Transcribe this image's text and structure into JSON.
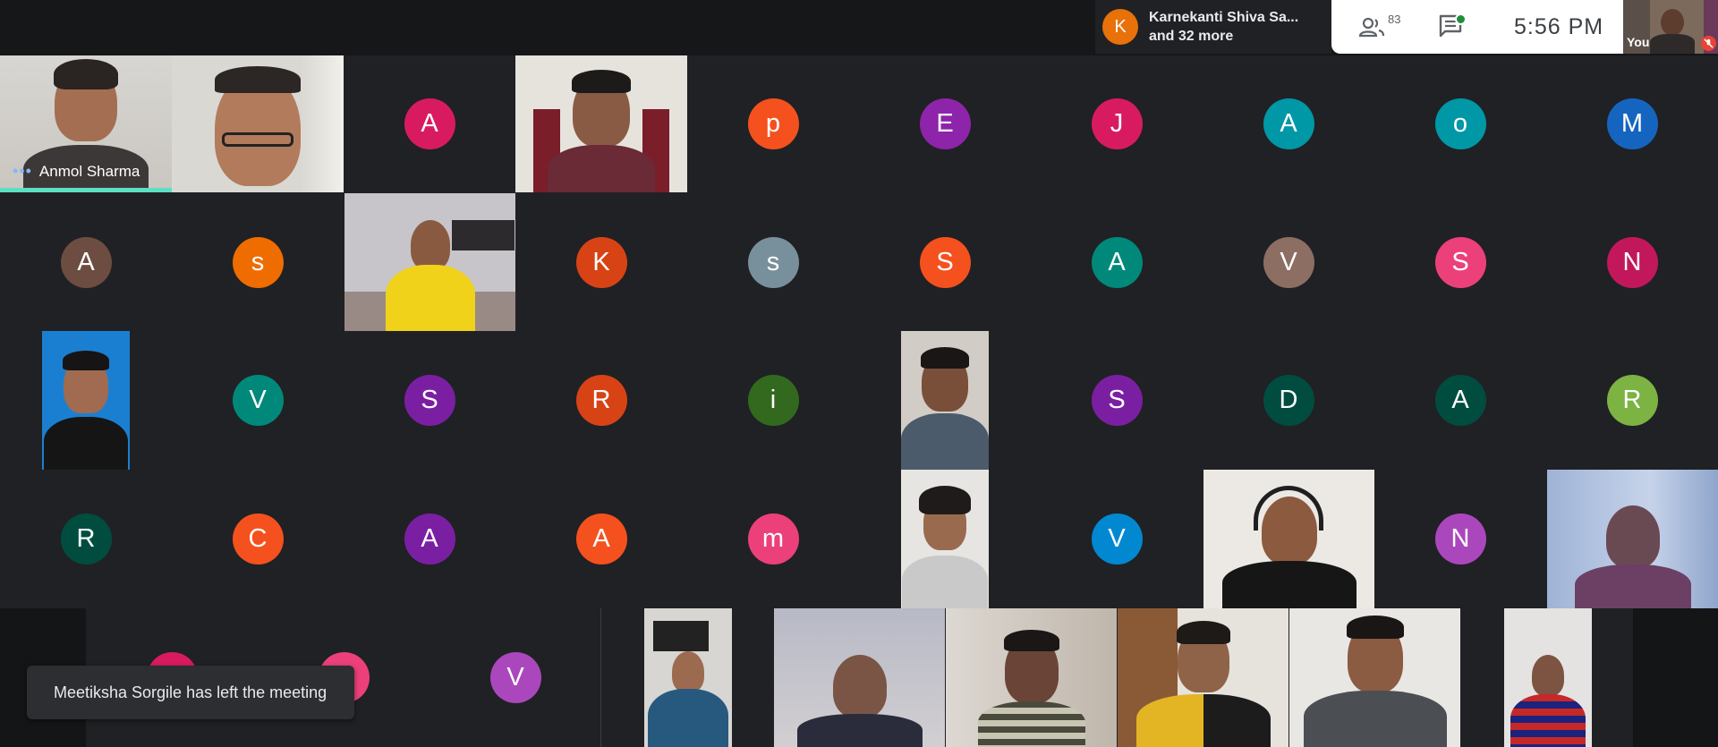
{
  "presenter": {
    "initial": "K",
    "line1": "Karnekanti Shiva Sa...",
    "line2": "and 32 more"
  },
  "controls": {
    "people_count": "83",
    "people_icon": "people-icon",
    "chat_icon": "chat-icon",
    "clock": "5:56 PM"
  },
  "self": {
    "label": "You",
    "mic_icon": "mic-off-icon"
  },
  "grid": {
    "row1": [
      {
        "kind": "video",
        "name": "Anmol Sharma"
      },
      {
        "kind": "video"
      },
      {
        "kind": "avatar",
        "letter": "A",
        "color": "#d81b60"
      },
      {
        "kind": "video"
      },
      {
        "kind": "avatar",
        "letter": "p",
        "color": "#f4511e"
      },
      {
        "kind": "avatar",
        "letter": "E",
        "color": "#8e24aa"
      },
      {
        "kind": "avatar",
        "letter": "J",
        "color": "#d81b60"
      },
      {
        "kind": "avatar",
        "letter": "A",
        "color": "#0097a7"
      },
      {
        "kind": "avatar",
        "letter": "o",
        "color": "#0097a7"
      },
      {
        "kind": "avatar",
        "letter": "M",
        "color": "#1565c0"
      }
    ],
    "row2": [
      {
        "kind": "avatar",
        "letter": "A",
        "color": "#6d4c41"
      },
      {
        "kind": "avatar",
        "letter": "s",
        "color": "#ef6c00"
      },
      {
        "kind": "video"
      },
      {
        "kind": "avatar",
        "letter": "K",
        "color": "#d84315"
      },
      {
        "kind": "avatar",
        "letter": "s",
        "color": "#78909c"
      },
      {
        "kind": "avatar",
        "letter": "S",
        "color": "#f4511e"
      },
      {
        "kind": "avatar",
        "letter": "A",
        "color": "#00897b"
      },
      {
        "kind": "avatar",
        "letter": "V",
        "color": "#8d6e63"
      },
      {
        "kind": "avatar",
        "letter": "S",
        "color": "#ec407a"
      },
      {
        "kind": "avatar",
        "letter": "N",
        "color": "#c2185b"
      }
    ],
    "row3": [
      {
        "kind": "video"
      },
      {
        "kind": "avatar",
        "letter": "V",
        "color": "#00897b"
      },
      {
        "kind": "avatar",
        "letter": "S",
        "color": "#7b1fa2"
      },
      {
        "kind": "avatar",
        "letter": "R",
        "color": "#d84315"
      },
      {
        "kind": "avatar",
        "letter": "i",
        "color": "#33691e"
      },
      {
        "kind": "video"
      },
      {
        "kind": "avatar",
        "letter": "S",
        "color": "#7b1fa2"
      },
      {
        "kind": "avatar",
        "letter": "D",
        "color": "#004d40"
      },
      {
        "kind": "avatar",
        "letter": "A",
        "color": "#004d40"
      },
      {
        "kind": "avatar",
        "letter": "R",
        "color": "#7cb342"
      }
    ],
    "row4": [
      {
        "kind": "avatar",
        "letter": "R",
        "color": "#004d40"
      },
      {
        "kind": "avatar",
        "letter": "C",
        "color": "#f4511e"
      },
      {
        "kind": "avatar",
        "letter": "A",
        "color": "#7b1fa2"
      },
      {
        "kind": "avatar",
        "letter": "A",
        "color": "#f4511e"
      },
      {
        "kind": "avatar",
        "letter": "m",
        "color": "#ec407a"
      },
      {
        "kind": "video"
      },
      {
        "kind": "avatar",
        "letter": "V",
        "color": "#0288d1"
      },
      {
        "kind": "video"
      },
      {
        "kind": "avatar",
        "letter": "N",
        "color": "#ab47bc"
      },
      {
        "kind": "video"
      }
    ],
    "row5_avatars": [
      {
        "letter": "",
        "color": "#d81b60"
      },
      {
        "letter": "",
        "color": "#ec407a"
      },
      {
        "letter": "V",
        "color": "#ab47bc"
      }
    ]
  },
  "toast": {
    "message": "Meetiksha Sorgile has left the meeting"
  }
}
